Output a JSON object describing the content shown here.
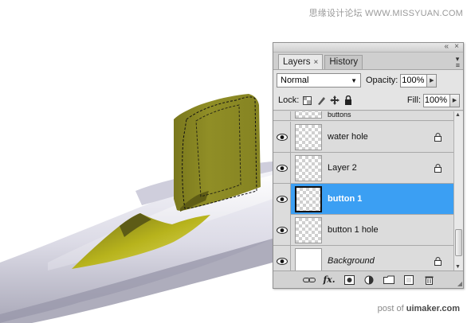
{
  "watermarks": {
    "top": "思缘设计论坛  WWW.MISSYUAN.COM",
    "bottom_prefix": "post of",
    "bottom_site": "uimaker.com"
  },
  "panel": {
    "tabs": [
      {
        "label": "Layers",
        "close": "×",
        "active": true
      },
      {
        "label": "History",
        "active": false
      }
    ],
    "window_buttons": {
      "collapse": "«",
      "close": "×"
    },
    "blend_mode": "Normal",
    "opacity_label": "Opacity:",
    "opacity_value": "100%",
    "lock_label": "Lock:",
    "fill_label": "Fill:",
    "fill_value": "100%",
    "partial_layer_name": "buttons",
    "layers": [
      {
        "name": "water hole",
        "visible": true,
        "locked": true,
        "selected": false
      },
      {
        "name": "Layer 2",
        "visible": true,
        "locked": true,
        "selected": false
      },
      {
        "name": "button 1",
        "visible": true,
        "locked": false,
        "selected": true
      },
      {
        "name": "button 1 hole",
        "visible": true,
        "locked": false,
        "selected": false
      },
      {
        "name": "Background",
        "visible": true,
        "locked": true,
        "selected": false
      }
    ],
    "bottom_buttons": [
      "link-icon",
      "fx-icon",
      "mask-icon",
      "adjustment-icon",
      "folder-icon",
      "new-layer-icon",
      "trash-icon"
    ],
    "fx_label": "fx."
  },
  "colors": {
    "selection": "#3b9ff3",
    "olive": "#8c8a22",
    "yellow_green": "#b9b61a"
  }
}
